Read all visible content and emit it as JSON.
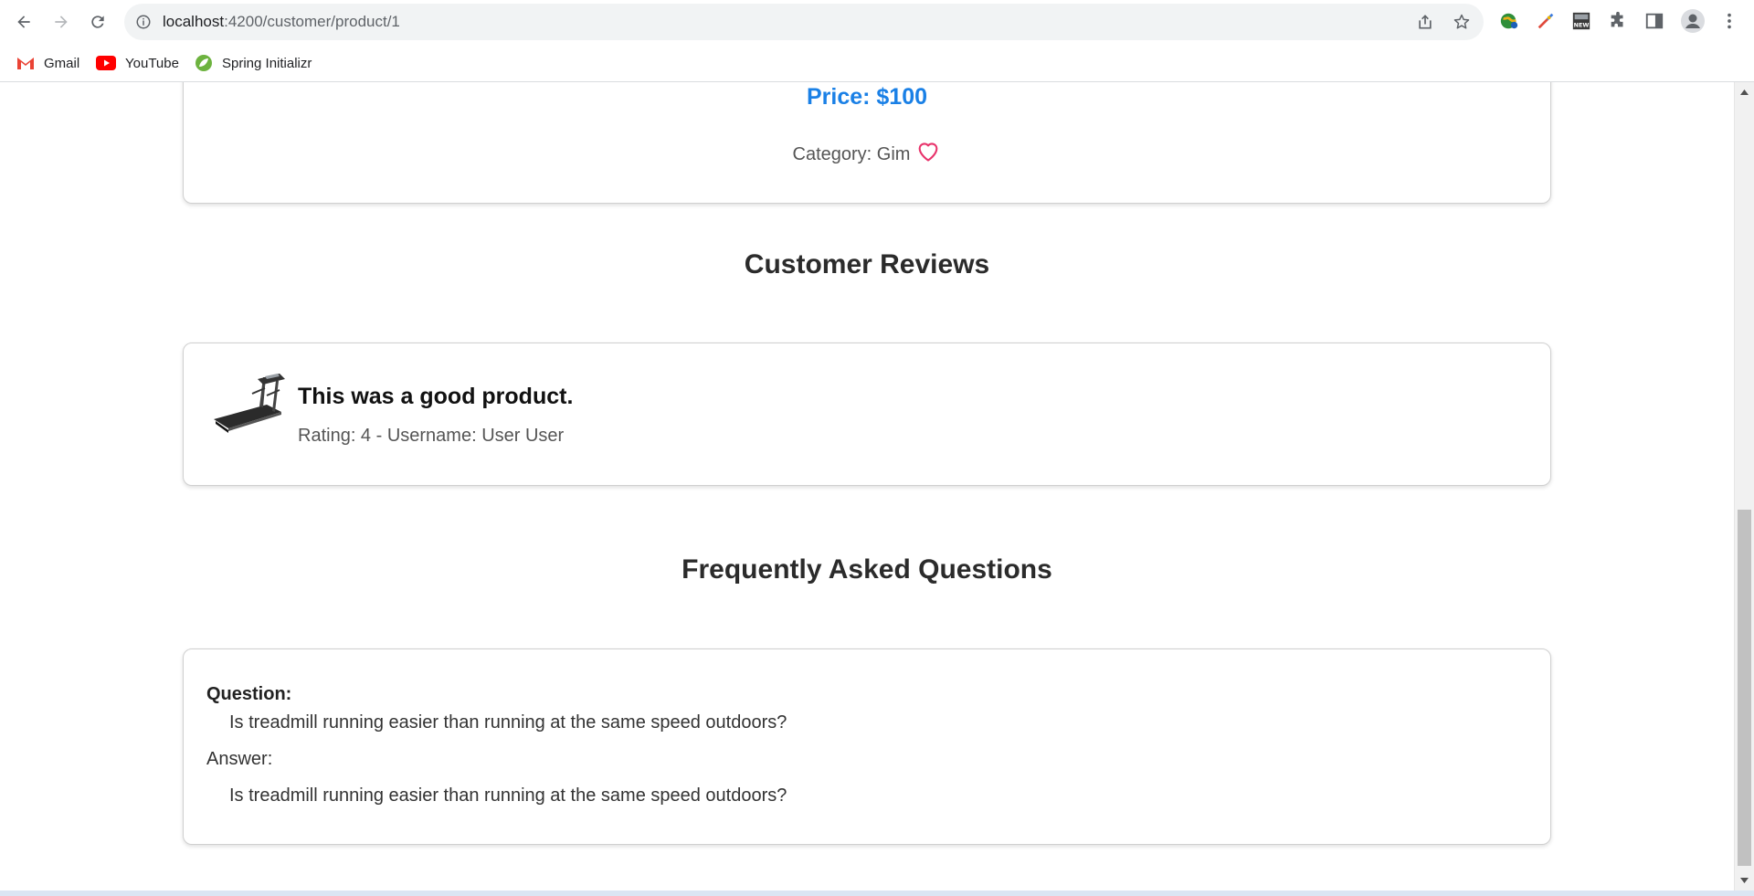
{
  "browser": {
    "url_host": "localhost",
    "url_path": ":4200/customer/product/1",
    "bookmarks": [
      {
        "label": "Gmail"
      },
      {
        "label": "YouTube"
      },
      {
        "label": "Spring Initializr"
      }
    ]
  },
  "product": {
    "price": "Price: $100",
    "category": "Category: Gim"
  },
  "reviews": {
    "heading": "Customer Reviews",
    "items": [
      {
        "title": "This was a good product.",
        "meta": "Rating: 4 - Username: User User"
      }
    ]
  },
  "faq": {
    "heading": "Frequently Asked Questions",
    "items": [
      {
        "question_label": "Question:",
        "question": "Is treadmill running easier than running at the same speed outdoors?",
        "answer_label": "Answer:",
        "answer": "Is treadmill running easier than running at the same speed outdoors?"
      }
    ]
  },
  "colors": {
    "price": "#1a80e6",
    "heart": "#e8336b"
  }
}
